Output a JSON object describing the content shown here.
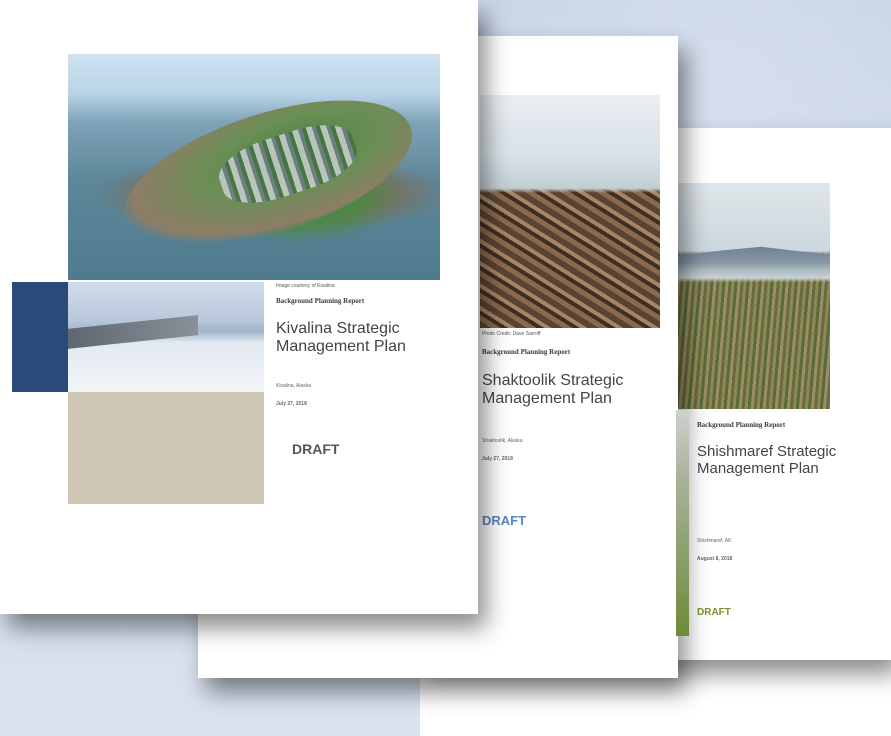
{
  "documents": [
    {
      "id": "kivalina",
      "photo_caption": "Image courtesy of Kivalina",
      "report_label": "Background Planning Report",
      "title_line1": "Kivalina Strategic",
      "title_line2": "Management Plan",
      "location": "Kivalina, Alaska",
      "date": "July 27, 2018",
      "status": "DRAFT"
    },
    {
      "id": "shaktoolik",
      "photo_caption": "Photo Credit: Dave Sarroff",
      "report_label": "Background Planning Report",
      "title_line1": "Shaktoolik Strategic",
      "title_line2": "Management Plan",
      "location": "Shaktoolik, Alaska",
      "date": "July 27, 2018",
      "status": "DRAFT"
    },
    {
      "id": "shishmaref",
      "report_label": "Background Planning Report",
      "title_line1": "Shishmaref Strategic",
      "title_line2": "Management Plan",
      "location": "Shishmaref, AK",
      "date": "August 8, 2018",
      "status": "DRAFT"
    }
  ],
  "colors": {
    "navy_accent": "#2a4a7a",
    "tan_accent": "#ccc6b3",
    "shaktoolik_draft": "#5b86c0",
    "shishmaref_draft": "#7d9434",
    "shishmaref_side_strip": "#6f8a3a"
  }
}
